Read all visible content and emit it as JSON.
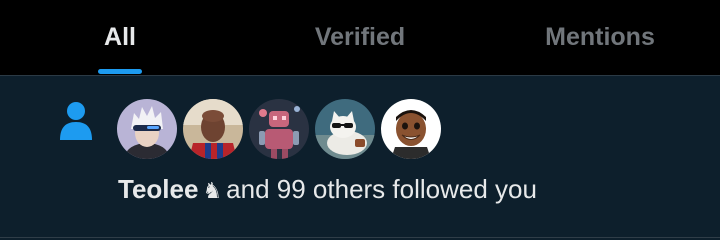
{
  "tabs": [
    {
      "label": "All",
      "active": true
    },
    {
      "label": "Verified",
      "active": false
    },
    {
      "label": "Mentions",
      "active": false
    }
  ],
  "colors": {
    "accent": "#1d9bf0",
    "background": "#0d1f2c",
    "tabbar_background": "#000000",
    "text_primary": "#e7e9ea",
    "text_secondary": "#71767b"
  },
  "notification": {
    "type_icon": "person-icon",
    "avatars": [
      {
        "icon": "avatar-white-hair-visor"
      },
      {
        "icon": "avatar-man-red-blue-shirt"
      },
      {
        "icon": "avatar-pink-robot"
      },
      {
        "icon": "avatar-cat-sunglasses"
      },
      {
        "icon": "avatar-cartoon-smiling-man"
      }
    ],
    "name": "Teolee",
    "name_badge_icon": "chess-knight-icon",
    "text": "and 99 others followed you"
  }
}
